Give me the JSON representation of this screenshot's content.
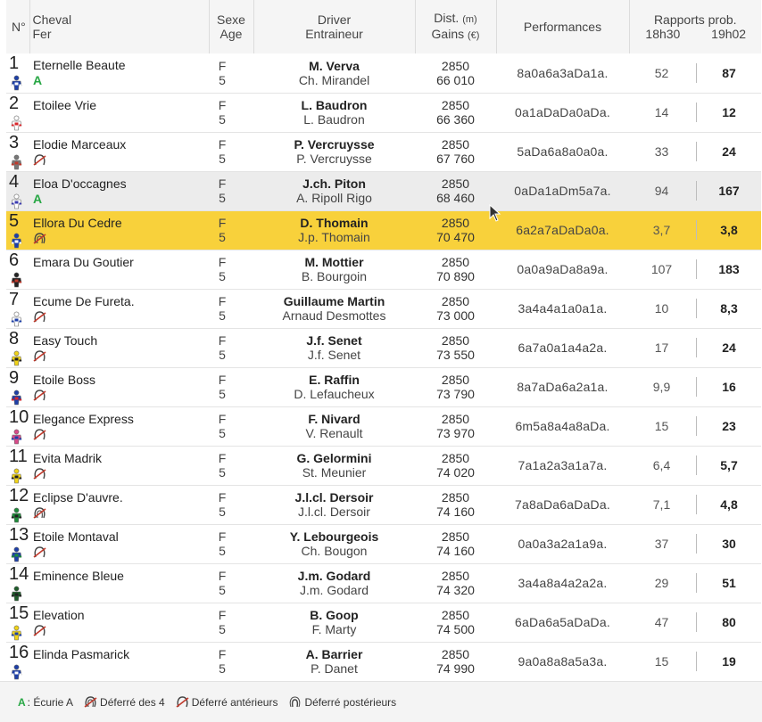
{
  "header": {
    "num": "N°",
    "cheval_1": "Cheval",
    "cheval_2": "Fer",
    "sexe_1": "Sexe",
    "sexe_2": "Age",
    "driver_1": "Driver",
    "driver_2": "Entraineur",
    "dist_1": "Dist.",
    "dist_unit": "(m)",
    "dist_2": "Gains",
    "gains_unit": "(€)",
    "perf": "Performances",
    "rapports": "Rapports prob.",
    "time_1": "18h30",
    "time_2": "19h02"
  },
  "colors": {
    "highlight": "#f8d13b",
    "grey_row": "#ececec",
    "ecurie_green": "#28a745",
    "shoe_red": "#c0392b"
  },
  "rows": [
    {
      "num": "1",
      "name": "Eternelle Beaute",
      "tag": "A",
      "shoe": "",
      "sex": "F",
      "age": "5",
      "driver": "M. Verva",
      "trainer": "Ch. Mirandel",
      "dist": "2850",
      "gains": "66 010",
      "perf": "8a0a6a3aDa1a.",
      "odd1": "52",
      "odd2": "87",
      "jc1": "#1d3fa8",
      "jc2": "#ffffff"
    },
    {
      "num": "2",
      "name": "Etoilee Vrie",
      "tag": "",
      "shoe": "",
      "sex": "F",
      "age": "5",
      "driver": "L. Baudron",
      "trainer": "L. Baudron",
      "dist": "2850",
      "gains": "66 360",
      "perf": "0a1aDaDa0aDa.",
      "odd1": "14",
      "odd2": "12",
      "jc1": "#ffffff",
      "jc2": "#d8262b"
    },
    {
      "num": "3",
      "name": "Elodie Marceaux",
      "tag": "",
      "shoe": "ant",
      "sex": "F",
      "age": "5",
      "driver": "P. Vercruysse",
      "trainer": "P. Vercruysse",
      "dist": "2850",
      "gains": "67 760",
      "perf": "5aDa6a8a0a0a.",
      "odd1": "33",
      "odd2": "24",
      "jc1": "#777777",
      "jc2": "#c0392b"
    },
    {
      "num": "4",
      "name": "Eloa D'occagnes",
      "tag": "A",
      "shoe": "",
      "sex": "F",
      "age": "5",
      "driver": "J.ch. Piton",
      "trainer": "A. Ripoll Rigo",
      "dist": "2850",
      "gains": "68 460",
      "perf": "0aDa1aDm5a7a.",
      "odd1": "94",
      "odd2": "167",
      "jc1": "#ffffff",
      "jc2": "#3b3bb0"
    },
    {
      "num": "5",
      "name": "Ellora Du Cedre",
      "tag": "",
      "shoe": "4",
      "sex": "F",
      "age": "5",
      "driver": "D. Thomain",
      "trainer": "J.p. Thomain",
      "dist": "2850",
      "gains": "70 470",
      "perf": "6a2a7aDaDa0a.",
      "odd1": "3,7",
      "odd2": "3,8",
      "jc1": "#1d3fa8",
      "jc2": "#ffffff"
    },
    {
      "num": "6",
      "name": "Emara Du Goutier",
      "tag": "",
      "shoe": "",
      "sex": "F",
      "age": "5",
      "driver": "M. Mottier",
      "trainer": "B. Bourgoin",
      "dist": "2850",
      "gains": "70 890",
      "perf": "0a0a9aDa8a9a.",
      "odd1": "107",
      "odd2": "183",
      "jc1": "#222222",
      "jc2": "#c0392b"
    },
    {
      "num": "7",
      "name": "Ecume De Fureta.",
      "tag": "",
      "shoe": "ant",
      "sex": "F",
      "age": "5",
      "driver": "Guillaume Martin",
      "trainer": "Arnaud Desmottes",
      "dist": "2850",
      "gains": "73 000",
      "perf": "3a4a4a1a0a1a.",
      "odd1": "10",
      "odd2": "8,3",
      "jc1": "#ffffff",
      "jc2": "#1d3fa8"
    },
    {
      "num": "8",
      "name": "Easy Touch",
      "tag": "",
      "shoe": "ant",
      "sex": "F",
      "age": "5",
      "driver": "J.f. Senet",
      "trainer": "J.f. Senet",
      "dist": "2850",
      "gains": "73 550",
      "perf": "6a7a0a1a4a2a.",
      "odd1": "17",
      "odd2": "24",
      "jc1": "#f1d418",
      "jc2": "#222222"
    },
    {
      "num": "9",
      "name": "Etoile Boss",
      "tag": "",
      "shoe": "ant",
      "sex": "F",
      "age": "5",
      "driver": "E. Raffin",
      "trainer": "D. Lefaucheux",
      "dist": "2850",
      "gains": "73 790",
      "perf": "8a7aDa6a2a1a.",
      "odd1": "9,9",
      "odd2": "16",
      "jc1": "#1d3fa8",
      "jc2": "#d8262b"
    },
    {
      "num": "10",
      "name": "Elegance Express",
      "tag": "",
      "shoe": "ant",
      "sex": "F",
      "age": "5",
      "driver": "F. Nivard",
      "trainer": "V. Renault",
      "dist": "2850",
      "gains": "73 970",
      "perf": "6m5a8a4a8aDa.",
      "odd1": "15",
      "odd2": "23",
      "jc1": "#d84a8a",
      "jc2": "#1d3fa8"
    },
    {
      "num": "11",
      "name": "Evita Madrik",
      "tag": "",
      "shoe": "ant",
      "sex": "F",
      "age": "5",
      "driver": "G. Gelormini",
      "trainer": "St. Meunier",
      "dist": "2850",
      "gains": "74 020",
      "perf": "7a1a2a3a1a7a.",
      "odd1": "6,4",
      "odd2": "5,7",
      "jc1": "#f1d418",
      "jc2": "#222222"
    },
    {
      "num": "12",
      "name": "Eclipse D'auvre.",
      "tag": "",
      "shoe": "4",
      "sex": "F",
      "age": "5",
      "driver": "J.l.cl. Dersoir",
      "trainer": "J.l.cl. Dersoir",
      "dist": "2850",
      "gains": "74 160",
      "perf": "7a8aDa6aDaDa.",
      "odd1": "7,1",
      "odd2": "4,8",
      "jc1": "#1e8c3a",
      "jc2": "#222222"
    },
    {
      "num": "13",
      "name": "Etoile Montaval",
      "tag": "",
      "shoe": "ant",
      "sex": "F",
      "age": "5",
      "driver": "Y. Lebourgeois",
      "trainer": "Ch. Bougon",
      "dist": "2850",
      "gains": "74 160",
      "perf": "0a0a3a2a1a9a.",
      "odd1": "37",
      "odd2": "30",
      "jc1": "#1d3fa8",
      "jc2": "#1e8c3a"
    },
    {
      "num": "14",
      "name": "Eminence Bleue",
      "tag": "",
      "shoe": "",
      "sex": "F",
      "age": "5",
      "driver": "J.m. Godard",
      "trainer": "J.m. Godard",
      "dist": "2850",
      "gains": "74 320",
      "perf": "3a4a8a4a2a2a.",
      "odd1": "29",
      "odd2": "51",
      "jc1": "#1e5c2a",
      "jc2": "#222222"
    },
    {
      "num": "15",
      "name": "Elevation",
      "tag": "",
      "shoe": "ant",
      "sex": "F",
      "age": "5",
      "driver": "B. Goop",
      "trainer": "F. Marty",
      "dist": "2850",
      "gains": "74 500",
      "perf": "6aDa6a5aDaDa.",
      "odd1": "47",
      "odd2": "80",
      "jc1": "#f1d418",
      "jc2": "#1d3fa8"
    },
    {
      "num": "16",
      "name": "Elinda Pasmarick",
      "tag": "",
      "shoe": "",
      "sex": "F",
      "age": "5",
      "driver": "A. Barrier",
      "trainer": "P. Danet",
      "dist": "2850",
      "gains": "74 990",
      "perf": "9a0a8a8a5a3a.",
      "odd1": "15",
      "odd2": "19",
      "jc1": "#1d3fa8",
      "jc2": "#ffffff"
    }
  ],
  "highlight_row": 4,
  "grey_row": 3,
  "legend": {
    "a_symbol": "A",
    "a_text": ": Écurie A",
    "d4": "Déferré des 4",
    "dant": "Déferré antérieurs",
    "dpost": "Déferré postérieurs"
  }
}
